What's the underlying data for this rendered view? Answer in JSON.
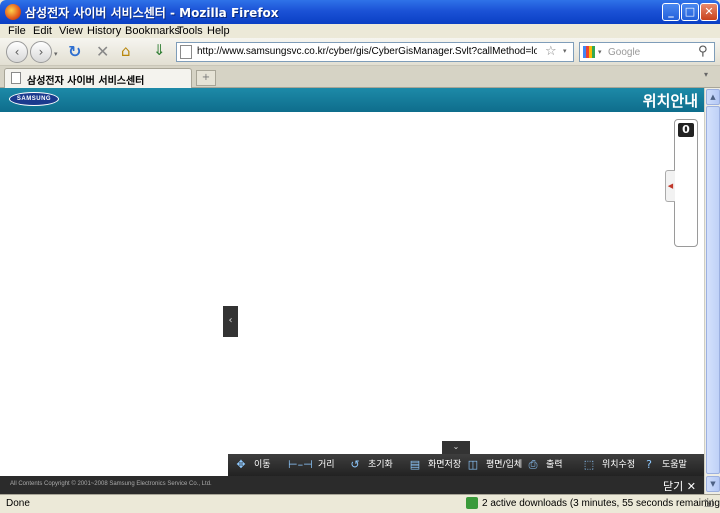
{
  "window": {
    "title": "삼성전자 사이버 서비스센터 - Mozilla Firefox",
    "controls": {
      "minimize": "_",
      "maximize": "□",
      "close": "✕"
    }
  },
  "menu": [
    "File",
    "Edit",
    "View",
    "History",
    "Bookmarks",
    "Tools",
    "Help"
  ],
  "navbar": {
    "url": "http://www.samsungsvc.co.kr/cyber/gis/CyberGisManager.Svlt?callMethod=locationSearch&c",
    "search_placeholder": "Google"
  },
  "tabs": [
    {
      "label": "삼성전자 사이버 서비스센터"
    }
  ],
  "page": {
    "logo": "SAMSUNG",
    "title": "위치안내",
    "zoom_level": "0",
    "toolbar": [
      {
        "label": "이동",
        "icon": "move-icon"
      },
      {
        "label": "거리",
        "icon": "ruler-icon"
      },
      {
        "label": "초기화",
        "icon": "reset-icon"
      },
      {
        "label": "화면저장",
        "icon": "save-screen-icon"
      },
      {
        "label": "평면/입체",
        "icon": "layers-icon"
      },
      {
        "label": "출력",
        "icon": "print-icon"
      },
      {
        "label": "위치수정",
        "icon": "location-edit-icon"
      },
      {
        "label": "도움말",
        "icon": "help-icon"
      }
    ],
    "copyright": "All Contents Copyright © 2001~2008 Samsung Electronics Service Co., Ltd.",
    "close_label": "닫기 ✕"
  },
  "status": {
    "text": "Done",
    "downloads": "2 active downloads (3 minutes, 55 seconds remaining)"
  },
  "colors": {
    "accent": "#0e6d8c",
    "toolbar": "#2b2b2b"
  }
}
